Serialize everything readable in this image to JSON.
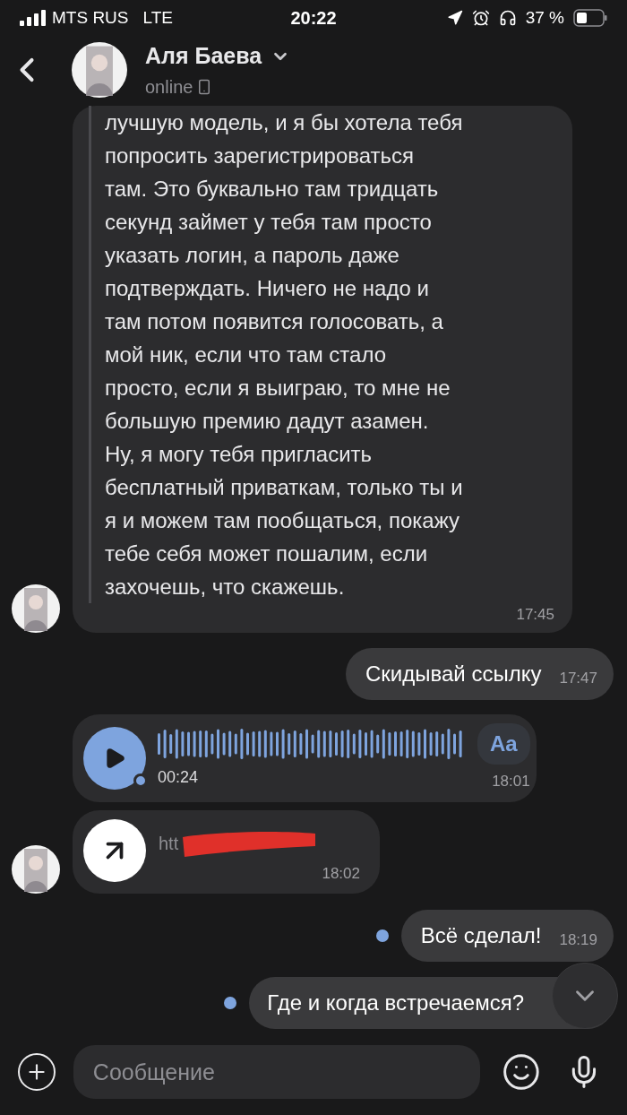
{
  "status_bar": {
    "carrier": "MTS RUS",
    "network": "LTE",
    "time": "20:22",
    "battery": "37 %"
  },
  "header": {
    "name": "Аля Баева",
    "status": "online"
  },
  "messages": [
    {
      "kind": "text",
      "outgoing": false,
      "avatar": true,
      "quote": true,
      "text": "лучшую модель, и я бы хотела тебя\nпопросить зарегистрироваться\nтам. Это буквально там тридцать\nсекунд займет у тебя там просто\nуказать логин, а пароль даже\nподтверждать. Ничего не надо и\nтам потом появится голосовать, а\nмой ник, если что там стало\nпросто, если я выиграю, то мне не\nбольшую премию дадут азамен.\nНу, я могу тебя пригласить\nбесплатный приваткам, только ты и\nя и можем там пообщаться, покажу\nтебе себя может пошалим, если\nзахочешь, что скажешь.",
      "time": "17:45"
    },
    {
      "kind": "text",
      "outgoing": true,
      "unread": false,
      "text": "Скидывай ссылку",
      "time": "17:47"
    },
    {
      "kind": "voice",
      "outgoing": false,
      "avatar": false,
      "duration": "00:24",
      "transcribe": "Aa",
      "time": "18:01"
    },
    {
      "kind": "link",
      "outgoing": false,
      "avatar": true,
      "text": "htt",
      "time": "18:02"
    },
    {
      "kind": "text",
      "outgoing": true,
      "unread": true,
      "text": "Всё сделал!",
      "time": "18:19"
    },
    {
      "kind": "text",
      "outgoing": true,
      "unread": true,
      "text": "Где и когда встречаемся?"
    }
  ],
  "composer": {
    "placeholder": "Сообщение"
  }
}
